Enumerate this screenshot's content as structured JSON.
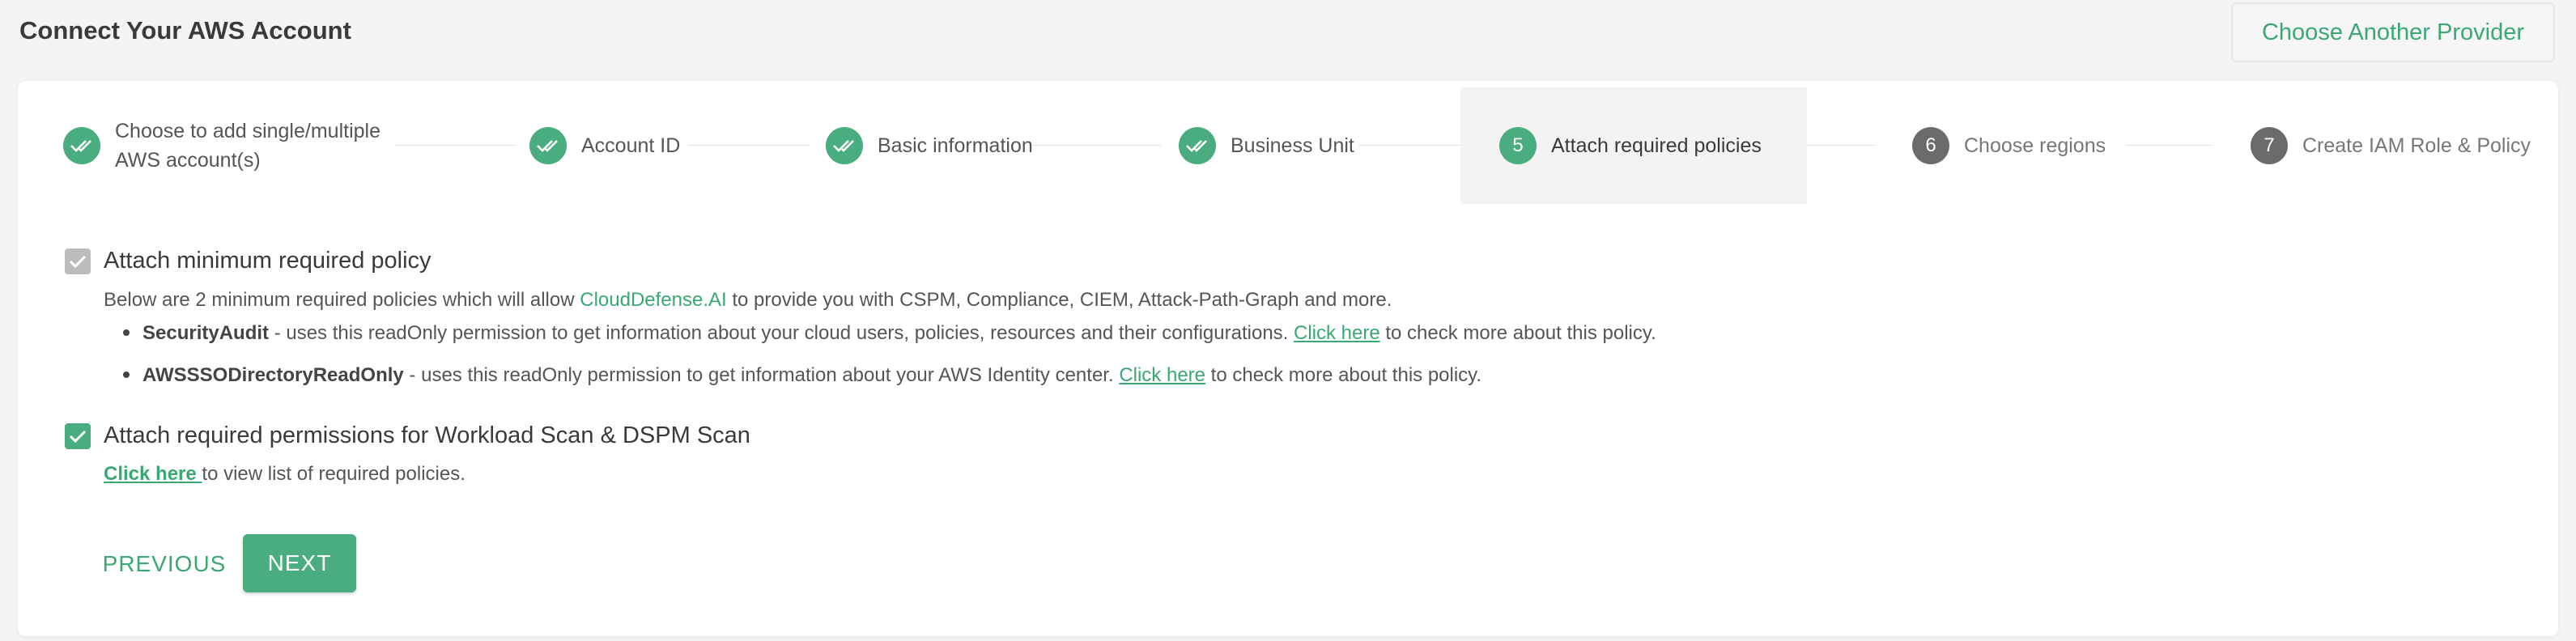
{
  "header": {
    "title": "Connect Your AWS Account",
    "provider_button": "Choose Another Provider"
  },
  "stepper": {
    "steps": [
      {
        "label_line1": "Choose to add single/multiple",
        "label_line2": "AWS account(s)",
        "status": "done"
      },
      {
        "label": "Account ID",
        "status": "done"
      },
      {
        "label": "Basic information",
        "status": "done"
      },
      {
        "label": "Business Unit",
        "status": "done"
      },
      {
        "number": "5",
        "label": "Attach required policies",
        "status": "active"
      },
      {
        "number": "6",
        "label": "Choose regions",
        "status": "pending"
      },
      {
        "number": "7",
        "label": "Create IAM Role & Policy",
        "status": "pending"
      }
    ]
  },
  "policies": {
    "minimum": {
      "title": "Attach minimum required policy",
      "checked": true,
      "disabled": true,
      "desc_prefix": "Below are 2 minimum required policies which will allow ",
      "brand": "CloudDefense.AI",
      "desc_suffix": " to provide you with CSPM, Compliance, CIEM, Attack-Path-Graph and more.",
      "items": [
        {
          "name": "SecurityAudit",
          "text": " - uses this readOnly permission to get information about your cloud users, policies, resources and their configurations. ",
          "link": "Click here",
          "after": " to check more about this policy."
        },
        {
          "name": "AWSSSODirectoryReadOnly",
          "text": " - uses this readOnly permission to get information about your AWS Identity center. ",
          "link": "Click here",
          "after": " to check more about this policy."
        }
      ]
    },
    "workload": {
      "title": "Attach required permissions for Workload Scan & DSPM Scan",
      "checked": true,
      "link": "Click here ",
      "after": "to view list of required policies."
    }
  },
  "actions": {
    "previous": "PREVIOUS",
    "next": "NEXT"
  },
  "colors": {
    "accent": "#49ad7f",
    "link": "#3aa873",
    "pending": "#6b6b6b"
  }
}
